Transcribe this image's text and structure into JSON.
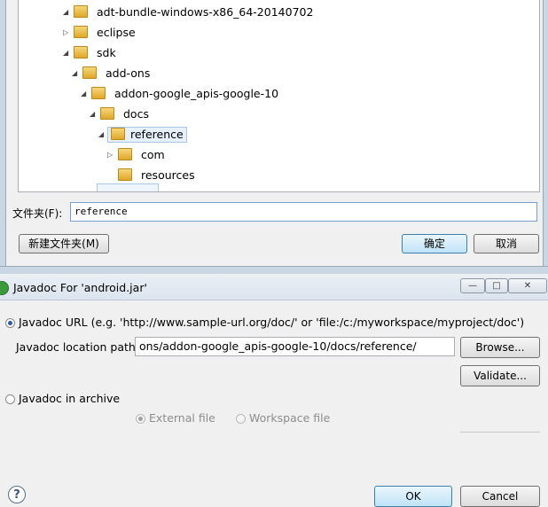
{
  "folder_dialog": {
    "tree": [
      {
        "label": "adt-bundle-windows-x86_64-20140702",
        "expand": "open",
        "selected": false
      },
      {
        "label": "eclipse",
        "expand": "closed",
        "selected": false
      },
      {
        "label": "sdk",
        "expand": "open",
        "selected": false
      },
      {
        "label": "add-ons",
        "expand": "open",
        "selected": false
      },
      {
        "label": "addon-google_apis-google-10",
        "expand": "open",
        "selected": false
      },
      {
        "label": "docs",
        "expand": "open",
        "selected": false
      },
      {
        "label": "reference",
        "expand": "open",
        "selected": true
      },
      {
        "label": "com",
        "expand": "closed",
        "selected": false
      },
      {
        "label": "resources",
        "expand": "none",
        "selected": false
      }
    ],
    "folder_label": "文件夹(F):",
    "folder_value": "reference",
    "new_folder_button": "新建文件夹(M)",
    "ok_button": "确定",
    "cancel_button": "取消"
  },
  "javadoc_dialog": {
    "title": "Javadoc For 'android.jar'",
    "window_buttons": {
      "minimize": "—",
      "maximize": "□",
      "close": "✕"
    },
    "url_option": "Javadoc URL (e.g. 'http://www.sample-url.org/doc/' or 'file:/c:/myworkspace/myproject/doc')",
    "location_label": "Javadoc location path:",
    "location_value": "ons/addon-google_apis-google-10/docs/reference/",
    "browse_button": "Browse...",
    "validate_button": "Validate...",
    "archive_option": "Javadoc in archive",
    "external_file": "External file",
    "workspace_file": "Workspace file",
    "help_symbol": "?",
    "ok_button": "OK",
    "cancel_button": "Cancel"
  }
}
